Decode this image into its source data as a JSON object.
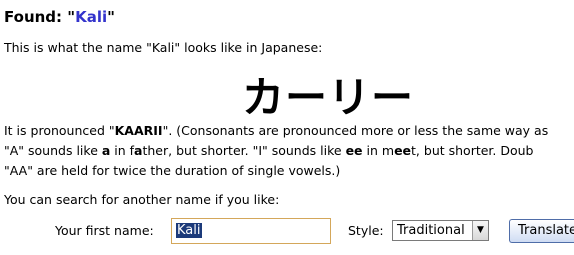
{
  "found": {
    "prefix": "Found: ",
    "quote_open": "\"",
    "name": "Kali",
    "quote_close": "\""
  },
  "intro_text": "This is what the name \"Kali\" looks like in Japanese:",
  "katakana": "カーリー",
  "pronunciation": {
    "prefix": "It is pronounced \"",
    "word": "KAARII",
    "suffix": "\". (Consonants are pronounced more or less the same way as",
    "line2_part1": "\"A\" sounds like ",
    "line2_bold1": "a",
    "line2_part2": " in f",
    "line2_bold2": "a",
    "line2_part3": "ther, but shorter. \"I\" sounds like ",
    "line2_bold3": "ee",
    "line2_part4": " in m",
    "line2_bold4": "ee",
    "line2_part5": "t, but shorter. Doub",
    "line3": "\"AA\" are held for twice the duration of single vowels.)"
  },
  "search_prompt": "You can search for another name if you like:",
  "form": {
    "first_name_label": "Your first name:",
    "first_name_value": "Kali",
    "style_label": "Style:",
    "style_selected": "Traditional",
    "translate_button": "Translate"
  },
  "colors": {
    "found_name": "#3333cc",
    "input_border": "#d4a75a",
    "selection": "#1c3a7a"
  }
}
